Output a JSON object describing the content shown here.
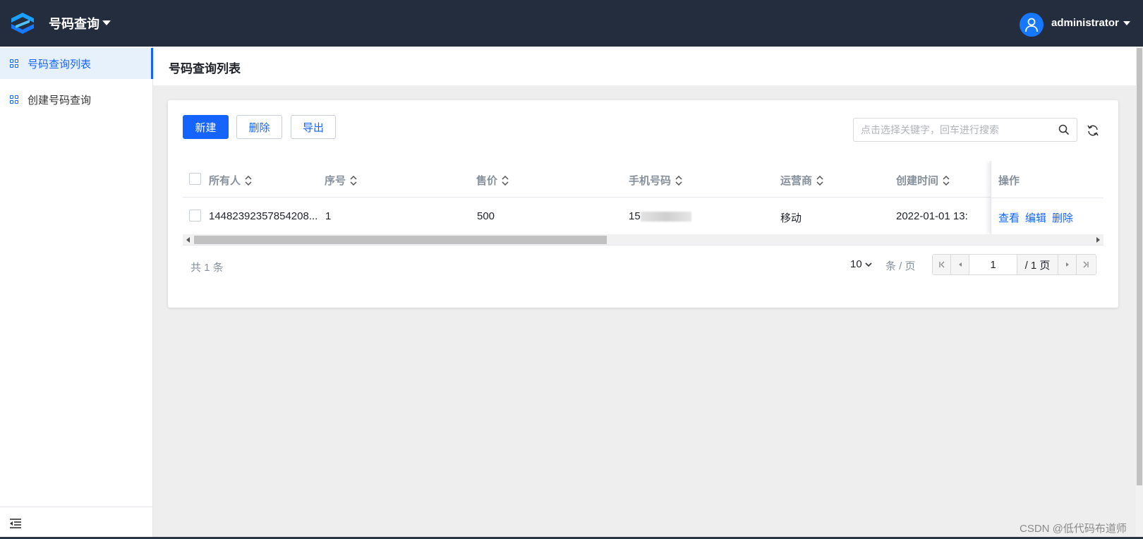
{
  "header": {
    "app_title": "号码查询",
    "username": "administrator"
  },
  "sidebar": {
    "items": [
      {
        "label": "号码查询列表",
        "active": true
      },
      {
        "label": "创建号码查询",
        "active": false
      }
    ]
  },
  "page": {
    "title": "号码查询列表"
  },
  "toolbar": {
    "new_label": "新建",
    "delete_label": "删除",
    "export_label": "导出",
    "search_placeholder": "点击选择关键字，回车进行搜索"
  },
  "table": {
    "columns": [
      "所有人",
      "序号",
      "售价",
      "手机号码",
      "运营商",
      "创建时间",
      "操作"
    ],
    "rows": [
      {
        "owner": "14482392357854208...",
        "index": "1",
        "price": "500",
        "phone": "15",
        "carrier": "移动",
        "created": "2022-01-01 13:",
        "actions": [
          "查看",
          "编辑",
          "删除"
        ]
      }
    ]
  },
  "pagination": {
    "total_text": "共 1 条",
    "page_size": "10",
    "page_size_unit": "条 / 页",
    "current_page": "1",
    "total_pages_text": "/ 1 页"
  },
  "watermark": "CSDN @低代码布道师",
  "colors": {
    "topbar": "#232d3d",
    "primary": "#1664ff",
    "sidebar_active_bg": "#e6f1fc",
    "page_bg": "#eeeeee"
  }
}
